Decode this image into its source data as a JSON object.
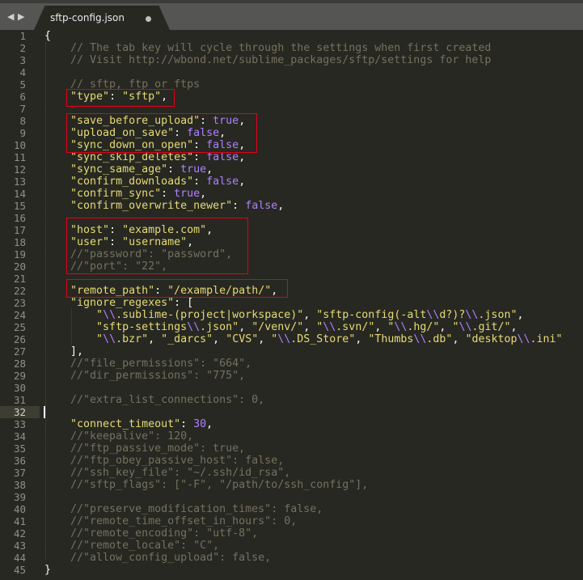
{
  "tab": {
    "title": "sftp-config.json",
    "nav_back": "◀",
    "nav_forward": "▶"
  },
  "colors": {
    "background": "#272822",
    "string": "#e6db74",
    "constant": "#ae81ff",
    "comment": "#75715e",
    "highlight_box": "#e5001a"
  },
  "current_line": 32,
  "lines": [
    "{",
    "    // The tab key will cycle through the settings when first created",
    "    // Visit http://wbond.net/sublime_packages/sftp/settings for help",
    "",
    "    // sftp, ftp or ftps",
    "    \"type\": \"sftp\",",
    "",
    "    \"save_before_upload\": true,",
    "    \"upload_on_save\": false,",
    "    \"sync_down_on_open\": false,",
    "    \"sync_skip_deletes\": false,",
    "    \"sync_same_age\": true,",
    "    \"confirm_downloads\": false,",
    "    \"confirm_sync\": true,",
    "    \"confirm_overwrite_newer\": false,",
    "",
    "    \"host\": \"example.com\",",
    "    \"user\": \"username\",",
    "    //\"password\": \"password\",",
    "    //\"port\": \"22\",",
    "",
    "    \"remote_path\": \"/example/path/\",",
    "    \"ignore_regexes\": [",
    "        \"\\\\.sublime-(project|workspace)\", \"sftp-config(-alt\\\\d?)?\\\\.json\",",
    "        \"sftp-settings\\\\.json\", \"/venv/\", \"\\\\.svn/\", \"\\\\.hg/\", \"\\\\.git/\",",
    "        \"\\\\.bzr\", \"_darcs\", \"CVS\", \"\\\\.DS_Store\", \"Thumbs\\\\.db\", \"desktop\\\\.ini\"",
    "    ],",
    "    //\"file_permissions\": \"664\",",
    "    //\"dir_permissions\": \"775\",",
    "",
    "    //\"extra_list_connections\": 0,",
    "",
    "    \"connect_timeout\": 30,",
    "    //\"keepalive\": 120,",
    "    //\"ftp_passive_mode\": true,",
    "    //\"ftp_obey_passive_host\": false,",
    "    //\"ssh_key_file\": \"~/.ssh/id_rsa\",",
    "    //\"sftp_flags\": [\"-F\", \"/path/to/ssh_config\"],",
    "",
    "    //\"preserve_modification_times\": false,",
    "    //\"remote_time_offset_in_hours\": 0,",
    "    //\"remote_encoding\": \"utf-8\",",
    "    //\"remote_locale\": \"C\",",
    "    //\"allow_config_upload\": false,",
    "}"
  ]
}
